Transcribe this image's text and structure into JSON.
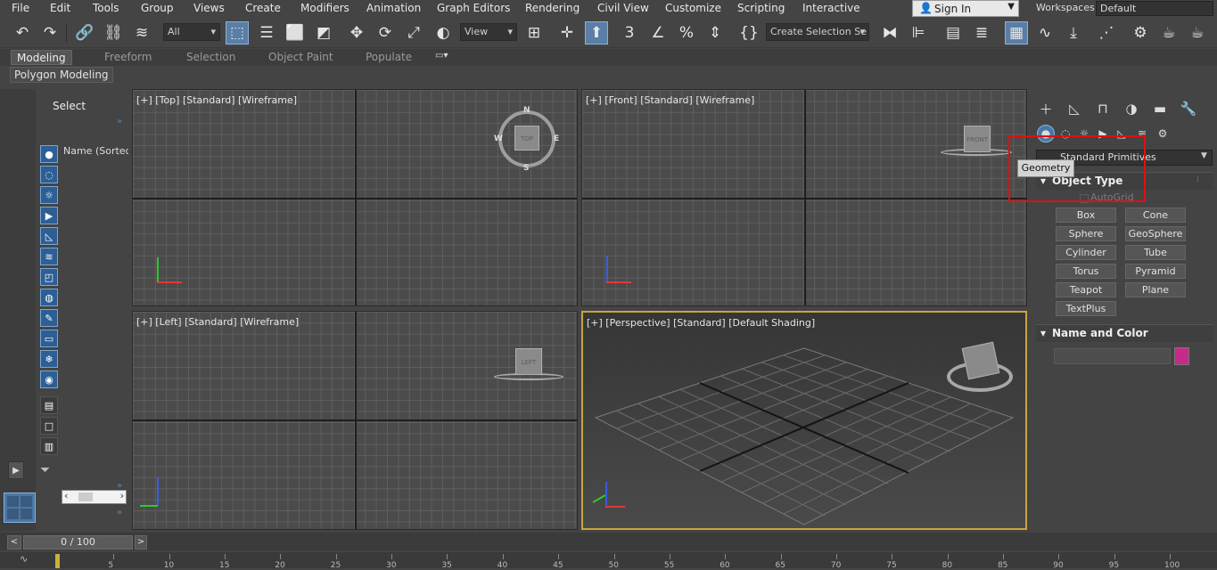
{
  "menubar": {
    "items": [
      "File",
      "Edit",
      "Tools",
      "Group",
      "Views",
      "Create",
      "Modifiers",
      "Animation",
      "Graph Editors",
      "Rendering",
      "Civil View",
      "Customize",
      "Scripting",
      "Interactive"
    ],
    "sign_in": "Sign In",
    "workspaces_label": "Workspaces:",
    "workspace_value": "Default"
  },
  "toolbar": {
    "filter_value": "All",
    "reference_coord": "View",
    "named_selection": "Create Selection Se"
  },
  "ribbon": {
    "tabs": [
      "Modeling",
      "Freeform",
      "Selection",
      "Object Paint",
      "Populate"
    ],
    "panel_label": "Polygon Modeling"
  },
  "scene_explorer": {
    "select_label": "Select",
    "column_header": "Name (Sorted A"
  },
  "viewports": {
    "top": {
      "label": "[+] [Top] [Standard] [Wireframe]",
      "cube": "TOP"
    },
    "front": {
      "label": "[+] [Front] [Standard] [Wireframe]",
      "cube": "FRONT"
    },
    "left": {
      "label": "[+] [Left] [Standard] [Wireframe]",
      "cube": "LEFT"
    },
    "perspective": {
      "label": "[+] [Perspective] [Standard] [Default Shading]"
    },
    "compass": {
      "n": "N",
      "s": "S",
      "e": "E",
      "w": "W"
    }
  },
  "command_panel": {
    "dropdown_value": "Standard Primitives",
    "tooltip": "Geometry",
    "object_type_title": "Object Type",
    "autogrid_label": "AutoGrid",
    "buttons": [
      "Box",
      "Cone",
      "Sphere",
      "GeoSphere",
      "Cylinder",
      "Tube",
      "Torus",
      "Pyramid",
      "Teapot",
      "Plane",
      "TextPlus"
    ],
    "name_color_title": "Name and Color",
    "object_color": "#c42b8a"
  },
  "timeline": {
    "frame_display": "0 / 100",
    "ticks": [
      "5",
      "10",
      "15",
      "20",
      "25",
      "30",
      "35",
      "40",
      "45",
      "50",
      "55",
      "60",
      "65",
      "70",
      "75",
      "80",
      "85",
      "90",
      "95",
      "100"
    ]
  }
}
